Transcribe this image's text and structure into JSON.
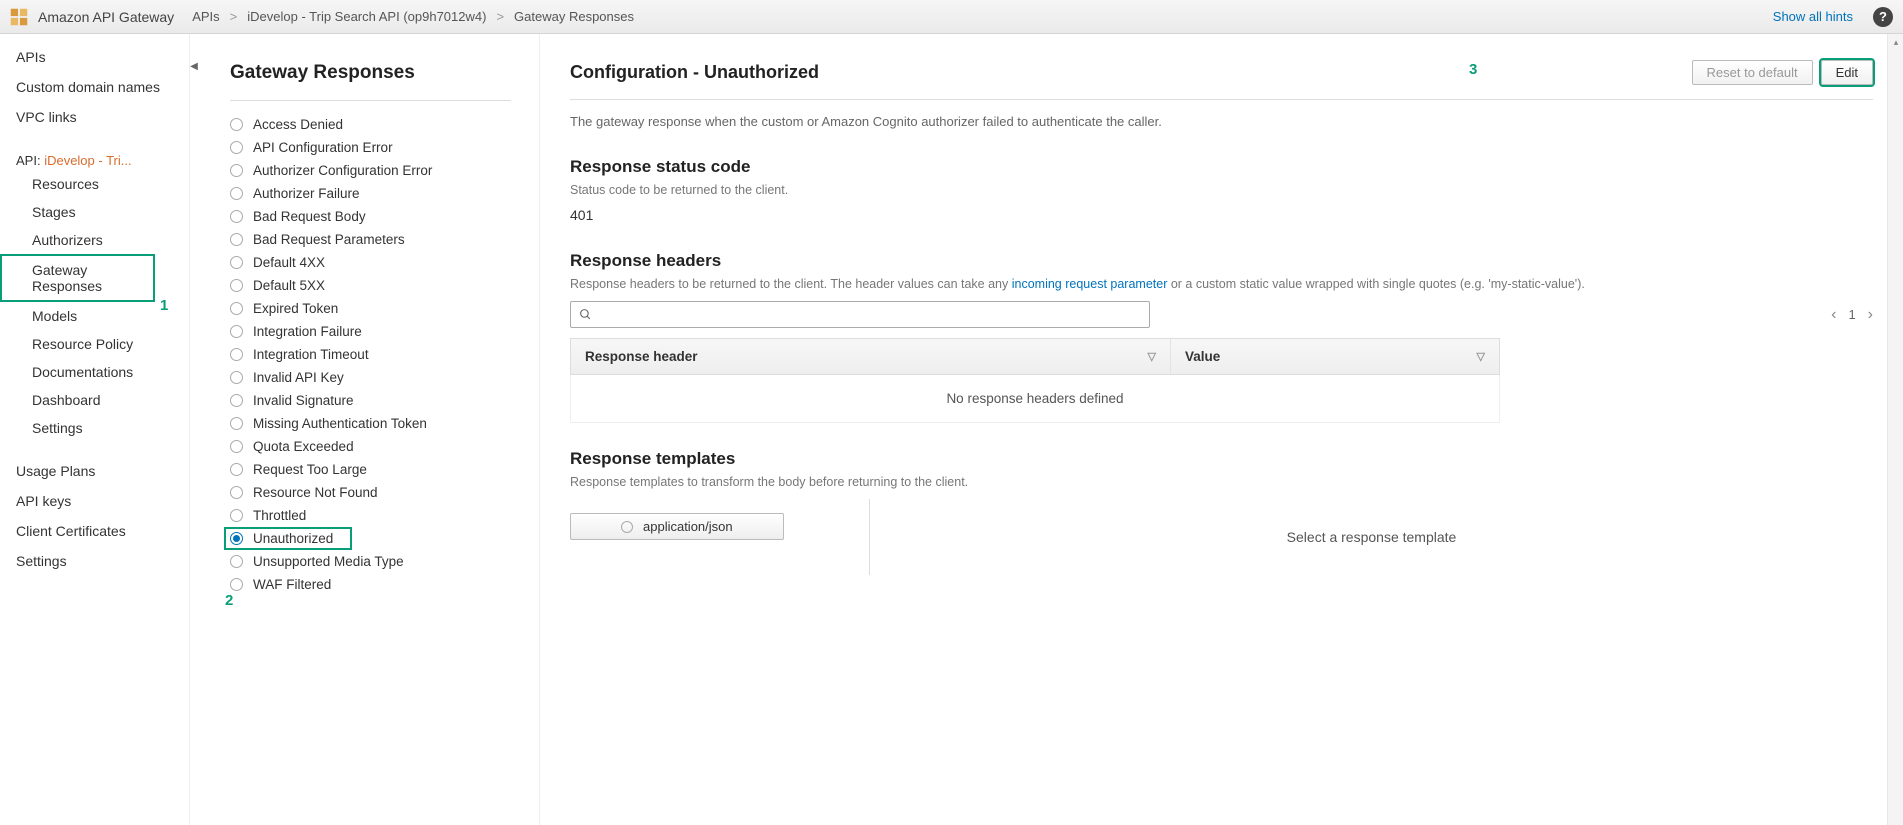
{
  "topbar": {
    "service": "Amazon API Gateway",
    "crumb_apis": "APIs",
    "crumb_api": "iDevelop - Trip Search API (op9h7012w4)",
    "crumb_section": "Gateway Responses",
    "hints": "Show all hints"
  },
  "sidebar": {
    "items_top": [
      "APIs",
      "Custom domain names",
      "VPC links"
    ],
    "api_label_prefix": "API: ",
    "api_name": "iDevelop - Tri...",
    "api_items": [
      "Resources",
      "Stages",
      "Authorizers",
      "Gateway Responses",
      "Models",
      "Resource Policy",
      "Documentations",
      "Dashboard",
      "Settings"
    ],
    "items_bottom": [
      "Usage Plans",
      "API keys",
      "Client Certificates",
      "Settings"
    ],
    "selected_api_item": "Gateway Responses"
  },
  "middle": {
    "title": "Gateway Responses",
    "responses": [
      "Access Denied",
      "API Configuration Error",
      "Authorizer Configuration Error",
      "Authorizer Failure",
      "Bad Request Body",
      "Bad Request Parameters",
      "Default 4XX",
      "Default 5XX",
      "Expired Token",
      "Integration Failure",
      "Integration Timeout",
      "Invalid API Key",
      "Invalid Signature",
      "Missing Authentication Token",
      "Quota Exceeded",
      "Request Too Large",
      "Resource Not Found",
      "Throttled",
      "Unauthorized",
      "Unsupported Media Type",
      "WAF Filtered"
    ],
    "selected": "Unauthorized"
  },
  "content": {
    "title": "Configuration - Unauthorized",
    "reset_btn": "Reset to default",
    "edit_btn": "Edit",
    "description": "The gateway response when the custom or Amazon Cognito authorizer failed to authenticate the caller.",
    "status_heading": "Response status code",
    "status_sub": "Status code to be returned to the client.",
    "status_value": "401",
    "headers_heading": "Response headers",
    "headers_sub_pre": "Response headers to be returned to the client. The header values can take any ",
    "headers_link": "incoming request parameter",
    "headers_sub_post": " or a custom static value wrapped with single quotes (e.g. 'my-static-value').",
    "page_number": "1",
    "th_header": "Response header",
    "th_value": "Value",
    "empty_headers": "No response headers defined",
    "templates_heading": "Response templates",
    "templates_sub": "Response templates to transform the body before returning to the client.",
    "template_option": "application/json",
    "template_prompt": "Select a response template"
  },
  "annotations": {
    "one": "1",
    "two": "2",
    "three": "3"
  }
}
